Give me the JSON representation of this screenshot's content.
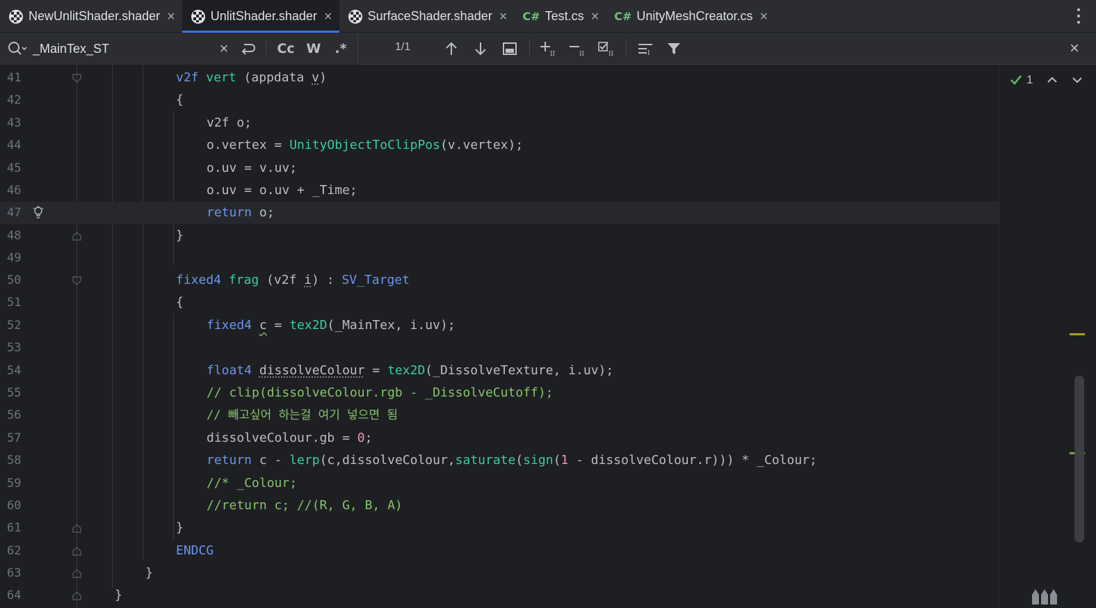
{
  "tabs": [
    {
      "label": "NewUnlitShader.shader",
      "icon": "shader-icon",
      "active": false
    },
    {
      "label": "UnlitShader.shader",
      "icon": "shader-icon",
      "active": true
    },
    {
      "label": "SurfaceShader.shader",
      "icon": "shader-icon",
      "active": false
    },
    {
      "label": "Test.cs",
      "icon": "csharp-icon",
      "prefix": "C#",
      "active": false
    },
    {
      "label": "UnityMeshCreator.cs",
      "icon": "csharp-icon",
      "prefix": "C#",
      "active": false
    }
  ],
  "find": {
    "query": "_MainTex_ST",
    "match_case_label": "Cc",
    "words_label": "W",
    "regex_label": ".*",
    "match_count": "1/1"
  },
  "inspection": {
    "count": "1"
  },
  "colors": {
    "accent": "#3574f0",
    "keyword": "#6c95eb",
    "function": "#39cc9b",
    "comment": "#85c46c",
    "number": "#ed94c0",
    "warning_marker": "#b39a2e",
    "info_marker": "#6fae46"
  },
  "editor": {
    "lines": [
      {
        "n": "41",
        "c1": "v2f ",
        "c2": "vert",
        "c3": " (appdata ",
        "c4": "v",
        "c5": ")"
      },
      {
        "n": "42",
        "t": "{"
      },
      {
        "n": "43",
        "t": "v2f o;"
      },
      {
        "n": "44",
        "c1": "o.vertex = ",
        "c2": "UnityObjectToClipPos",
        "c3": "(v.vertex);"
      },
      {
        "n": "45",
        "t": "o.uv = v.uv;"
      },
      {
        "n": "46",
        "t": "o.uv = o.uv + _Time;"
      },
      {
        "n": "47",
        "c1": "return",
        "c2": " o;"
      },
      {
        "n": "48",
        "t": "}"
      },
      {
        "n": "49",
        "t": ""
      },
      {
        "n": "50",
        "c1": "fixed4 ",
        "c2": "frag",
        "c3": " (v2f ",
        "c4": "i",
        "c5": ") : ",
        "c6": "SV_Target"
      },
      {
        "n": "51",
        "t": "{"
      },
      {
        "n": "52",
        "c1": "fixed4 ",
        "c2": "c",
        "c3": " = ",
        "c4": "tex2D",
        "c5": "(_MainTex, i.uv);"
      },
      {
        "n": "53",
        "t": ""
      },
      {
        "n": "54",
        "c1": "float4 ",
        "c2": "dissolveColour",
        "c3": " = ",
        "c4": "tex2D",
        "c5": "(_DissolveTexture, i.uv);"
      },
      {
        "n": "55",
        "t": "// clip(dissolveColour.rgb - _DissolveCutoff);"
      },
      {
        "n": "56",
        "t": "// 빼고싶어 하는걸 여기 넣으면 됨"
      },
      {
        "n": "57",
        "c1": "dissolveColour.gb = ",
        "c2": "0",
        "c3": ";"
      },
      {
        "n": "58",
        "c1": "return",
        "c2": " c - ",
        "c3": "lerp",
        "c4": "(c,dissolveColour,",
        "c5": "saturate",
        "c6": "(",
        "c7": "sign",
        "c8": "(",
        "c9": "1",
        "c10": " - dissolveColour.r))) * _Colour;"
      },
      {
        "n": "59",
        "t": "//* _Colour;"
      },
      {
        "n": "60",
        "t": "//return c; //(R, G, B, A)"
      },
      {
        "n": "61",
        "t": "}"
      },
      {
        "n": "62",
        "t": "ENDCG"
      },
      {
        "n": "63",
        "t": "}"
      },
      {
        "n": "64",
        "t": "}"
      }
    ]
  }
}
